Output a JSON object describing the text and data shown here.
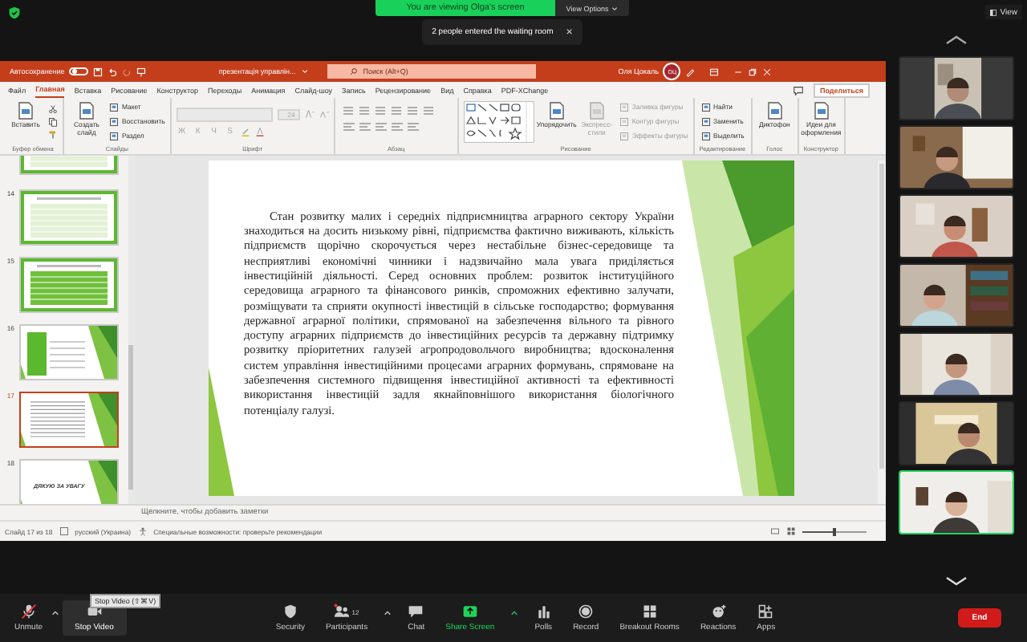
{
  "zoom_top": {
    "banner": "You are viewing Olga's screen",
    "view_options": "View Options",
    "toast": "2 people entered the waiting room",
    "toast_close": "×",
    "view_button": "View"
  },
  "powerpoint": {
    "autosave_label": "Автосохранение",
    "autosave_on": false,
    "file_title": "презентація управлін...",
    "search_placeholder": "Поиск (Alt+Q)",
    "user_name": "Оля Цокаль",
    "user_initials": "ОЦ",
    "tabs": [
      {
        "label": "Файл",
        "selected": false
      },
      {
        "label": "Главная",
        "selected": true
      },
      {
        "label": "Вставка",
        "selected": false
      },
      {
        "label": "Рисование",
        "selected": false
      },
      {
        "label": "Конструктор",
        "selected": false
      },
      {
        "label": "Переходы",
        "selected": false
      },
      {
        "label": "Анимация",
        "selected": false
      },
      {
        "label": "Слайд-шоу",
        "selected": false
      },
      {
        "label": "Запись",
        "selected": false
      },
      {
        "label": "Рецензирование",
        "selected": false
      },
      {
        "label": "Вид",
        "selected": false
      },
      {
        "label": "Справка",
        "selected": false
      },
      {
        "label": "PDF-XChange",
        "selected": false
      }
    ],
    "share_button": "Поделиться",
    "ribbon": [
      {
        "title": "Буфер обмена",
        "items": [
          {
            "kind": "large",
            "label": "Вставить",
            "disabled": false
          },
          {
            "kind": "clip-tools"
          }
        ]
      },
      {
        "title": "Слайды",
        "items": [
          {
            "kind": "large",
            "label": "Создать слайд",
            "disabled": false
          },
          {
            "kind": "small",
            "label": "Макет",
            "disabled": false
          },
          {
            "kind": "small",
            "label": "Восстановить",
            "disabled": false
          },
          {
            "kind": "small",
            "label": "Раздел",
            "disabled": false
          }
        ]
      },
      {
        "title": "Шрифт",
        "items": [
          {
            "kind": "font-tools",
            "size": "24",
            "glyphs": [
              "Ж",
              "К",
              "Ч",
              "S"
            ],
            "disabled": true
          }
        ]
      },
      {
        "title": "Абзац",
        "items": [
          {
            "kind": "paragraph-tools"
          }
        ]
      },
      {
        "title": "Рисование",
        "items": [
          {
            "kind": "shapes-gallery"
          },
          {
            "kind": "large",
            "label": "Упорядочить",
            "disabled": false
          },
          {
            "kind": "large",
            "label": "Экспресс-стили",
            "disabled": true
          },
          {
            "kind": "small",
            "label": "Заливка фигуры",
            "disabled": true
          },
          {
            "kind": "small",
            "label": "Контур фигуры",
            "disabled": true
          },
          {
            "kind": "small",
            "label": "Эффекты фигуры",
            "disabled": true
          }
        ]
      },
      {
        "title": "Редактирование",
        "items": [
          {
            "kind": "small",
            "label": "Найти",
            "disabled": false
          },
          {
            "kind": "small",
            "label": "Заменить",
            "disabled": false
          },
          {
            "kind": "small",
            "label": "Выделить",
            "disabled": false
          }
        ]
      },
      {
        "title": "Голос",
        "items": [
          {
            "kind": "large",
            "label": "Диктофон",
            "disabled": false
          }
        ]
      },
      {
        "title": "Конструктор",
        "items": [
          {
            "kind": "large",
            "label": "Идеи для оформления",
            "disabled": false
          }
        ]
      }
    ],
    "thumbnails": [
      {
        "kind": "table",
        "selected": false
      },
      {
        "number": "14",
        "kind": "table",
        "selected": false
      },
      {
        "number": "15",
        "kind": "table-dark",
        "selected": false
      },
      {
        "number": "16",
        "kind": "table-side",
        "selected": false
      },
      {
        "number": "17",
        "kind": "text",
        "selected": true
      },
      {
        "number": "18",
        "kind": "title",
        "title": "ДЯКУЮ ЗА УВАГУ",
        "selected": false
      }
    ],
    "slide_text": "Стан розвитку малих і середніх підприємництва аграрного сектору України знаходиться на досить низькому рівні, підприємства фактично виживають, кількість підприємств щорічно скорочується через нестабільне бізнес-середовище та несприятливі економічні чинники і надзвичайно мала увага приділяється інвестиційній діяльності. Серед основних проблем: розвиток інституційного середовища аграрного та фінансового ринків, спроможних ефективно залучати, розміщувати та сприяти окупності інвестицій в сільське господарство; формування державної аграрної політики, спрямованої на забезпечення вільного та рівного доступу аграрних підприємств до інвестиційних ресурсів та державну підтримку розвитку пріоритетних галузей агропродовольчого виробництва; вдосконалення систем управління інвестиційними процесами аграрних формувань, спрямоване на забезпечення системного підвищення інвестиційної активності та ефективності використання інвестицій задля якнайповнішого використання біологічного потенціалу галузі.",
    "notes_placeholder": "Щелкните, чтобы добавить заметки",
    "status_bar": {
      "slide_counter": "Слайд 17 из 18",
      "language": "русский (Украина)",
      "accessibility": "Специальные возможности: проверьте рекомендации",
      "zoom_slider": {
        "level": 0.5
      }
    }
  },
  "video_tiles": [
    {
      "kind": "picture",
      "active_speaker": false
    },
    {
      "kind": "picture",
      "active_speaker": false
    },
    {
      "kind": "picture",
      "active_speaker": false
    },
    {
      "kind": "picture",
      "active_speaker": false
    },
    {
      "kind": "picture",
      "active_speaker": false
    },
    {
      "kind": "picture",
      "active_speaker": false
    },
    {
      "kind": "picture",
      "active_speaker": true
    }
  ],
  "toolbar": {
    "left": [
      {
        "kind": "mic-muted",
        "label": "Unmute",
        "caret": true,
        "hovered": false,
        "highlighted": false
      },
      {
        "kind": "video",
        "label": "Stop Video",
        "caret": false,
        "hovered": true,
        "highlighted": false
      }
    ],
    "tooltip": "Stop Video (⇧⌘V)",
    "center": [
      {
        "kind": "shield",
        "label": "Security",
        "caret": false,
        "hovered": false,
        "highlighted": false
      },
      {
        "kind": "people",
        "label": "Participants",
        "badge": "12",
        "caret": true,
        "hovered": false,
        "highlighted": false
      },
      {
        "kind": "chat",
        "label": "Chat",
        "caret": false,
        "hovered": false,
        "highlighted": false
      },
      {
        "kind": "share",
        "label": "Share Screen",
        "caret": true,
        "hovered": false,
        "highlighted": true
      },
      {
        "kind": "polls",
        "label": "Polls",
        "caret": false,
        "hovered": false,
        "highlighted": false
      },
      {
        "kind": "record",
        "label": "Record",
        "caret": false,
        "hovered": false,
        "highlighted": false
      },
      {
        "kind": "rooms",
        "label": "Breakout Rooms",
        "caret": false,
        "hovered": false,
        "highlighted": false
      },
      {
        "kind": "reactions",
        "label": "Reactions",
        "caret": false,
        "hovered": false,
        "highlighted": false
      },
      {
        "kind": "apps",
        "label": "Apps",
        "caret": false,
        "hovered": false,
        "highlighted": false
      }
    ],
    "end_button": "End"
  }
}
